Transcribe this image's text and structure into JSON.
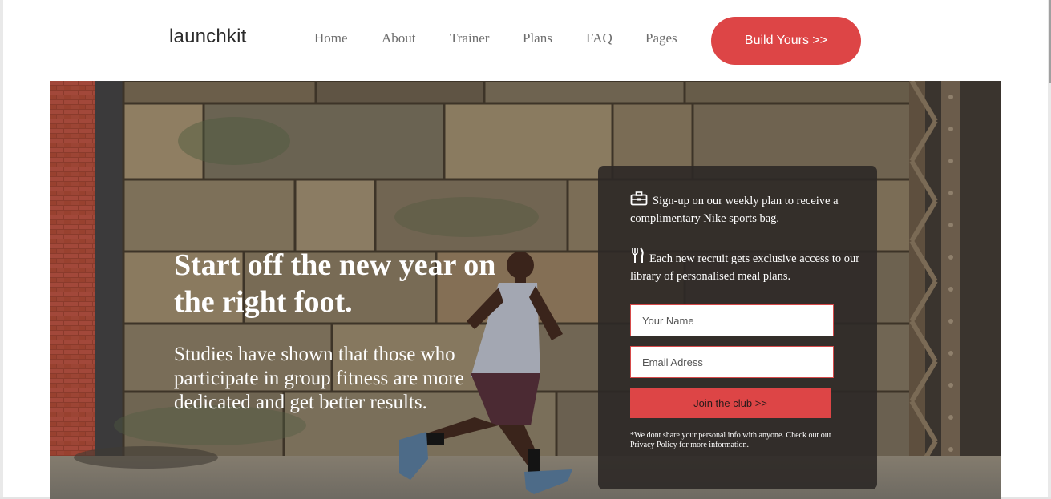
{
  "header": {
    "logo": "launchkit",
    "nav": [
      "Home",
      "About",
      "Trainer",
      "Plans",
      "FAQ",
      "Pages"
    ],
    "cta_label": "Build Yours >>"
  },
  "hero": {
    "title": "Start off the new year on the right foot.",
    "text": "Studies have shown that those who participate in group fitness are more dedicated and get better results."
  },
  "form": {
    "perks": [
      {
        "icon": "briefcase-icon",
        "text": "Sign-up on our weekly plan to receive a complimentary Nike sports bag."
      },
      {
        "icon": "fork-knife-icon",
        "text": "Each new recruit gets exclusive access to our library of personalised meal plans."
      }
    ],
    "name_placeholder": "Your Name",
    "email_placeholder": "Email Adress",
    "submit_label": "Join the club >>",
    "privacy_note": "*We dont share your personal info with anyone. Check out our Privacy Policy for more information."
  },
  "colors": {
    "accent": "#dd4546",
    "card_bg": "#2c2826",
    "nav_text": "#6e6e6e"
  }
}
